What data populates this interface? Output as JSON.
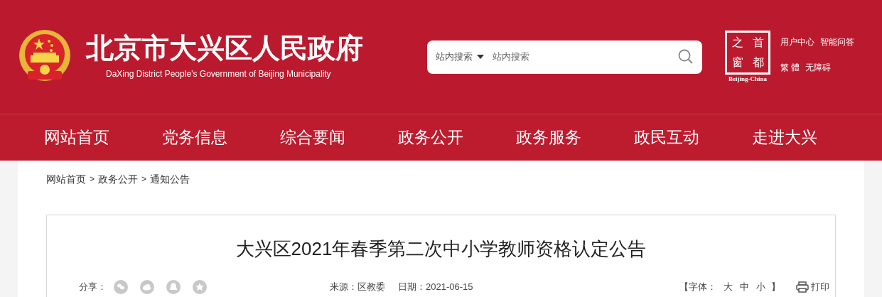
{
  "header": {
    "title": "北京市大兴区人民政府",
    "subtitle": "DaXing District People’s Government of Beijing Municipality"
  },
  "search": {
    "scope": "站内搜索",
    "placeholder": "站内搜索"
  },
  "badge": {
    "chars": [
      "之",
      "首",
      "窗",
      "都"
    ],
    "caption": "Beijing-China"
  },
  "top_links": [
    [
      "用户中心",
      "智能问答"
    ],
    [
      "繁 體",
      "无障碍"
    ]
  ],
  "nav": [
    "网站首页",
    "党务信息",
    "综合要闻",
    "政务公开",
    "政务服务",
    "政民互动",
    "走进大兴"
  ],
  "breadcrumb": [
    "网站首页",
    "政务公开",
    "通知公告"
  ],
  "breadcrumb_separator": ">",
  "article": {
    "title": "大兴区2021年春季第二次中小学教师资格认定公告",
    "share_label": "分享：",
    "source": "来源：区教委",
    "date": "日期：2021-06-15",
    "font_open": "【字体：",
    "font_sizes": [
      "大",
      "中",
      "小"
    ],
    "font_close": "】",
    "print": "打印"
  }
}
